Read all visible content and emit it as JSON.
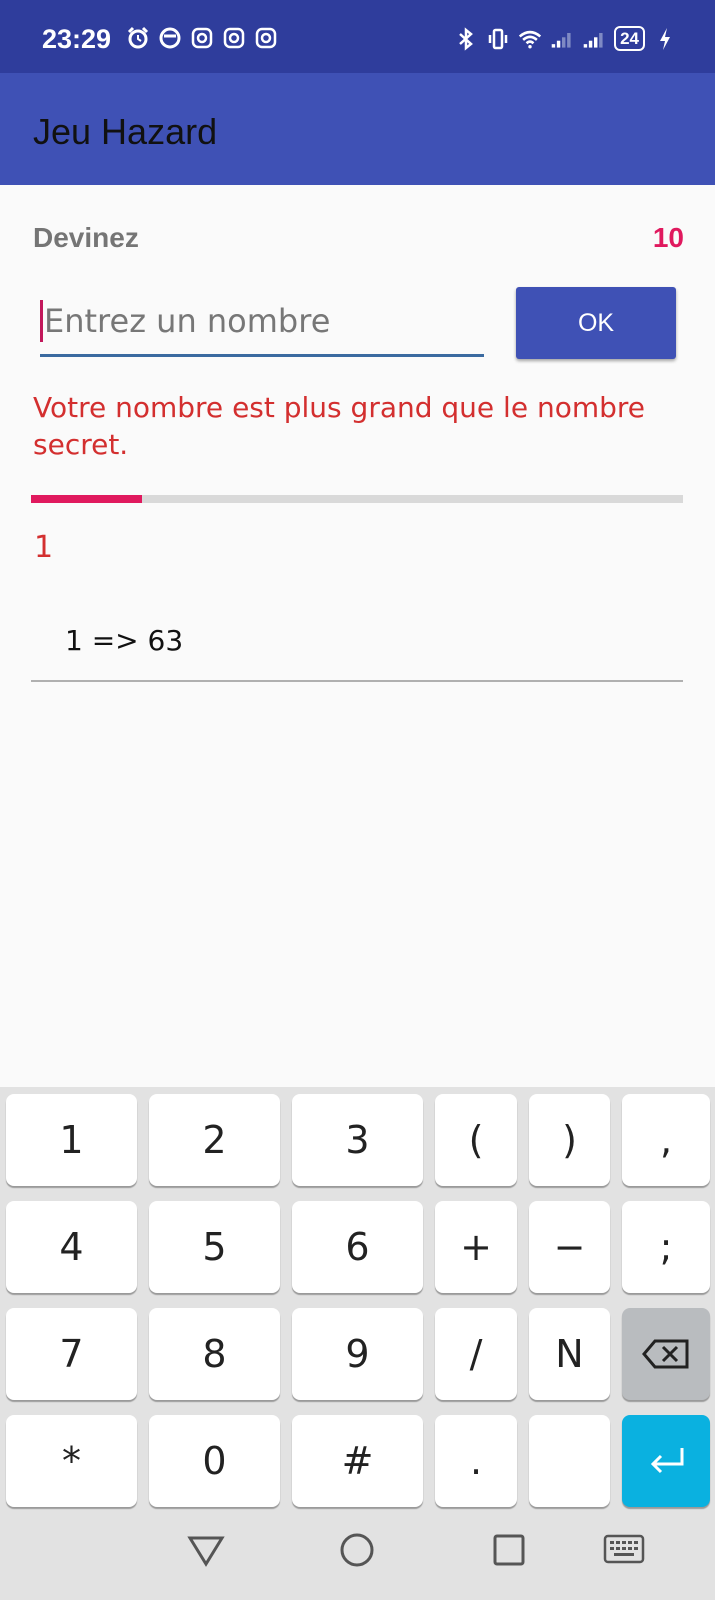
{
  "status_bar": {
    "time": "23:29",
    "battery": "24",
    "left_icons": [
      "alarm-icon",
      "notification-icon",
      "instagram-icon",
      "instagram-icon",
      "instagram-icon"
    ],
    "right_icons": [
      "bluetooth-icon",
      "vibrate-icon",
      "wifi-icon",
      "signal-icon",
      "signal-icon",
      "battery-icon",
      "charging-icon"
    ]
  },
  "app_bar": {
    "title": "Jeu Hazard"
  },
  "game": {
    "label": "Devinez",
    "attempts_remaining": "10",
    "input_placeholder": "Entrez un nombre",
    "input_value": "",
    "ok_label": "OK",
    "message": "Votre nombre est plus grand que le nombre secret.",
    "progress_fraction": 0.17,
    "attempt_count": "1",
    "history": [
      "1 => 63"
    ]
  },
  "keyboard": {
    "rows": [
      [
        "1",
        "2",
        "3",
        "(",
        ")",
        ","
      ],
      [
        "4",
        "5",
        "6",
        "+",
        "−",
        ";"
      ],
      [
        "7",
        "8",
        "9",
        "/",
        "N",
        "backspace"
      ],
      [
        "*",
        "0",
        "#",
        ".",
        "",
        "enter"
      ]
    ]
  },
  "colors": {
    "status_bar": "#2f3d9c",
    "app_bar": "#3f51b5",
    "accent": "#e0195e",
    "message": "#d32f2f",
    "enter_key": "#0ab1e0"
  },
  "nav_bar": {
    "buttons": [
      "back-icon",
      "home-icon",
      "recents-icon",
      "keyboard-icon"
    ]
  }
}
